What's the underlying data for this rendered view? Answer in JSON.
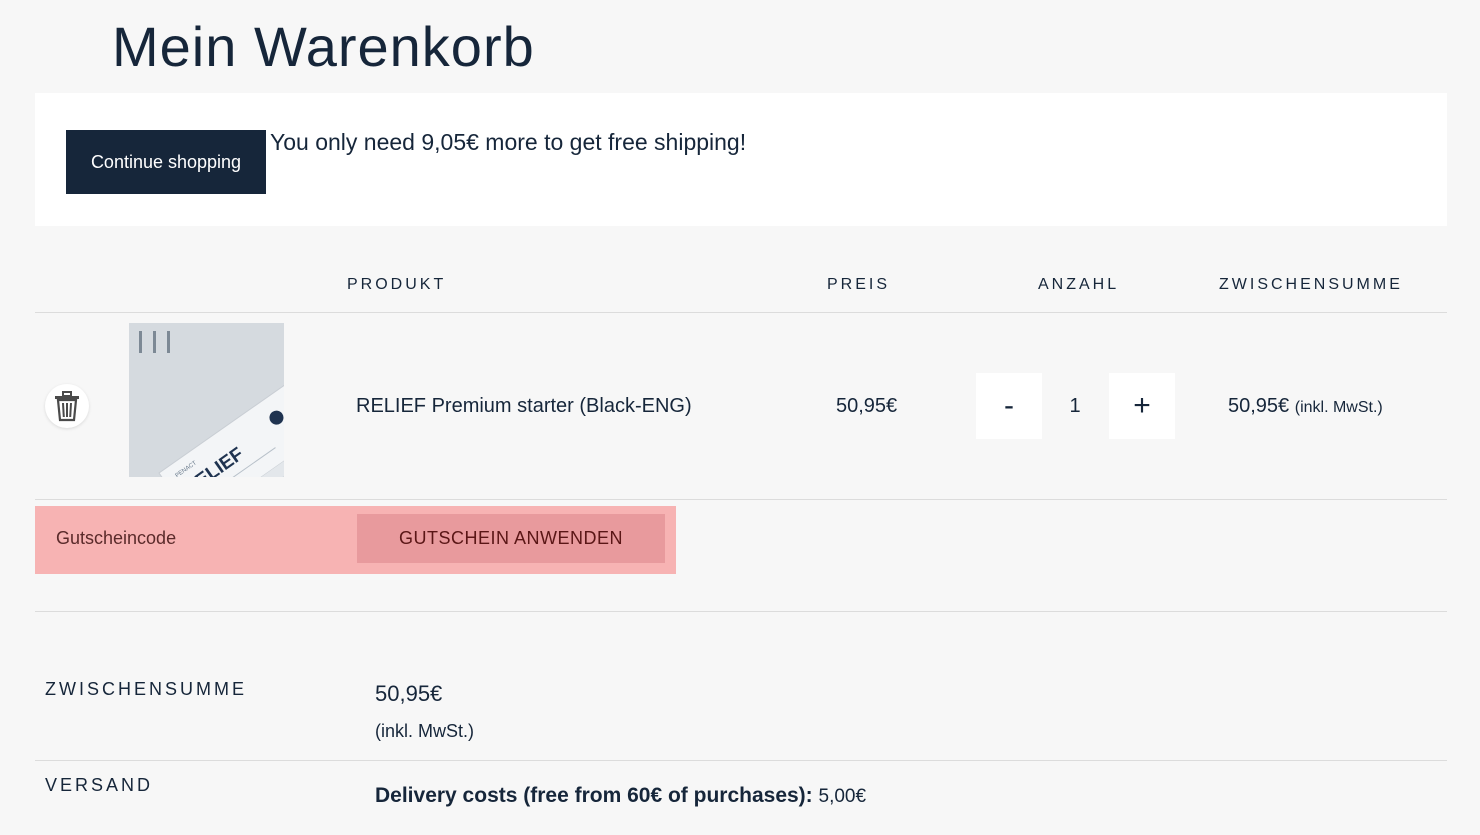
{
  "page": {
    "title": "Mein Warenkorb"
  },
  "notice": {
    "continue_label": "Continue shopping",
    "message": "You only need 9,05€ more to get free shipping!"
  },
  "table": {
    "headers": {
      "product": "PRODUKT",
      "price": "PREIS",
      "quantity": "ANZAHL",
      "subtotal": "ZWISCHENSUMME"
    },
    "items": [
      {
        "name": "RELIEF Premium starter (Black-ENG)",
        "price": "50,95€",
        "quantity": "1",
        "subtotal": "50,95€",
        "tax_note": "(inkl. MwSt.)",
        "thumbnail_text": "RELIEF",
        "thumbnail_brand": "PENACT"
      }
    ],
    "qty_minus": "-",
    "qty_plus": "+"
  },
  "coupon": {
    "placeholder": "Gutscheincode",
    "apply_label": "GUTSCHEIN ANWENDEN"
  },
  "totals": {
    "subtotal_label": "ZWISCHENSUMME",
    "subtotal_value": "50,95€",
    "subtotal_tax_note": "(inkl. MwSt.)",
    "shipping_label": "VERSAND",
    "shipping_method": "Delivery costs (free from 60€ of purchases):",
    "shipping_cost": "5,00€"
  },
  "colors": {
    "primary": "#16263a",
    "coupon_bg": "#f7b3b3",
    "coupon_button": "#e89a9d",
    "page_bg": "#f7f7f7"
  }
}
